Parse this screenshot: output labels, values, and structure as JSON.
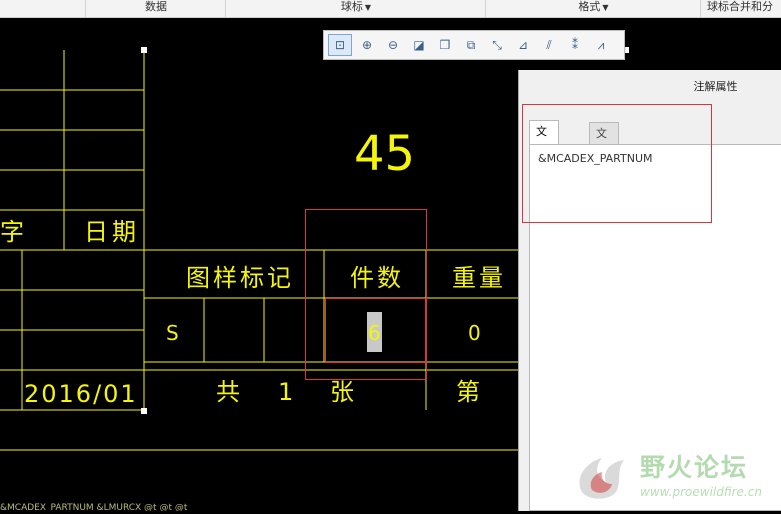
{
  "ribbon": {
    "groups": [
      "数据",
      "球标",
      "格式",
      "球标合并和分"
    ]
  },
  "drawing": {
    "title_big": "45",
    "zi": "字",
    "riqi": "日期",
    "tuyang": "图样标记",
    "jianshu": "件数",
    "zhongliang": "重量",
    "s_label": "S",
    "value_six": "6",
    "value_zero": "0",
    "date": "2016/01",
    "gong": "共",
    "one": "1",
    "zhang": "张",
    "di": "第",
    "bottom_text": "&MCADEX_PARTNUM  &LMURCX @t @t @t"
  },
  "zoombar": {
    "icons": [
      "zoom-window-icon",
      "zoom-in-icon",
      "zoom-out-icon",
      "shade-icon",
      "view-cube-icon",
      "copy-icon",
      "note-icon",
      "leader-icon",
      "attach-icon",
      "break-icon",
      "clip-icon"
    ]
  },
  "panel": {
    "title": "注解属性",
    "tab_text": "文本(E)",
    "tab_style": "文本样式(X)",
    "text_value": "&MCADEX_PARTNUM"
  },
  "watermark": {
    "name": "野火论坛",
    "url": "www.proewildfire.cn"
  },
  "colors": {
    "drawing_line": "#f5f50a",
    "highlight_box": "#d6373f",
    "handle": "#ffffff"
  }
}
